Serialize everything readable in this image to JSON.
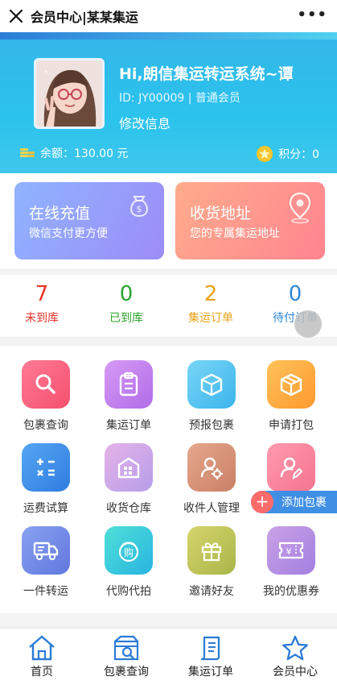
{
  "topbar": {
    "title": "会员中心|某某集运",
    "more": "•••"
  },
  "profile": {
    "greeting": "Hi,朗信集运转运系统~谭",
    "id_line": "ID: JY00009 | 普通会员",
    "edit": "修改信息",
    "balance": "余额：130.00 元",
    "points": "积分：0"
  },
  "cards": [
    {
      "title": "在线充值",
      "subtitle": "微信支付更方便"
    },
    {
      "title": "收货地址",
      "subtitle": "您的专属集运地址"
    }
  ],
  "stats": [
    {
      "value": "7",
      "label": "未到库",
      "color": "#e8342b"
    },
    {
      "value": "0",
      "label": "已到库",
      "color": "#2aa32c"
    },
    {
      "value": "2",
      "label": "集运订单",
      "color": "#e9a31b"
    },
    {
      "value": "0",
      "label": "待付订单",
      "color": "#2f88d9"
    }
  ],
  "grid": [
    {
      "label": "包裹查询",
      "icon": "search-icon"
    },
    {
      "label": "集运订单",
      "icon": "clipboard-icon"
    },
    {
      "label": "预报包裹",
      "icon": "box-icon"
    },
    {
      "label": "申请打包",
      "icon": "package-icon"
    },
    {
      "label": "运费试算",
      "icon": "calculator-icon"
    },
    {
      "label": "收货仓库",
      "icon": "warehouse-icon"
    },
    {
      "label": "收件人管理",
      "icon": "user-gear-icon"
    },
    {
      "label": "",
      "icon": "user-edit-icon"
    },
    {
      "label": "一件转运",
      "icon": "truck-icon"
    },
    {
      "label": "代购代拍",
      "icon": "shopping-bag-icon"
    },
    {
      "label": "邀请好友",
      "icon": "gift-icon"
    },
    {
      "label": "我的优惠券",
      "icon": "coupon-icon"
    }
  ],
  "floating": {
    "add_package": "添加包裹",
    "plus": "+"
  },
  "bottom_nav": [
    {
      "label": "首页",
      "icon": "home-icon"
    },
    {
      "label": "包裹查询",
      "icon": "package-search-icon"
    },
    {
      "label": "集运订单",
      "icon": "receipt-icon"
    },
    {
      "label": "会员中心",
      "icon": "star-icon"
    }
  ],
  "colors": {
    "accent": "#2f88d9",
    "hero": "#2bc3ec"
  }
}
